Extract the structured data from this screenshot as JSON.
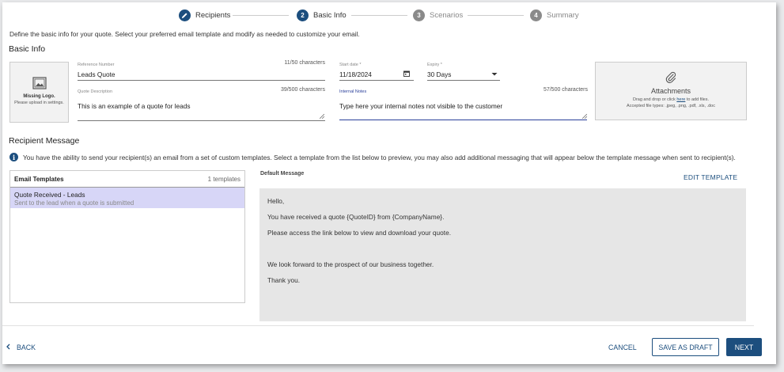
{
  "stepper": {
    "steps": [
      {
        "num": "",
        "label": "Recipients",
        "state": "done"
      },
      {
        "num": "2",
        "label": "Basic Info",
        "state": "active"
      },
      {
        "num": "3",
        "label": "Scenarios",
        "state": "todo"
      },
      {
        "num": "4",
        "label": "Summary",
        "state": "todo"
      }
    ]
  },
  "intro": "Define the basic info for your quote. Select your preferred email template and modify as needed to customize your email.",
  "basic_info": {
    "heading": "Basic Info",
    "logo": {
      "title": "Missing Logo.",
      "hint": "Please upload in settings."
    },
    "reference": {
      "label": "Reference Number",
      "count": "11/50 characters",
      "value": "Leads Quote"
    },
    "description": {
      "label": "Quote Description",
      "count": "39/500 characters",
      "value": "This is an example of a quote for leads"
    },
    "start_date": {
      "label": "Start date *",
      "value": "11/18/2024"
    },
    "expiry": {
      "label": "Expiry *",
      "value": "30 Days"
    },
    "internal_notes": {
      "label": "Internal Notes",
      "count": "57/500 characters",
      "value": "Type here your internal notes not visible to the customer"
    },
    "attachments": {
      "title": "Attachments",
      "line1_pre": "Drag and drop or click ",
      "line1_link": "here",
      "line1_post": " to add files.",
      "line2": "Accepted file types: .jpeg, .png, .pdf, .xls, .doc"
    }
  },
  "recipient": {
    "heading": "Recipient Message",
    "info": "You have the ability to send your recipient(s) an email from a set of custom templates. Select a template from the list below to preview, you may also add additional messaging that will appear below the template message when sent to recipient(s).",
    "templates_header": "Email Templates",
    "templates_count": "1 templates",
    "templates": [
      {
        "name": "Quote Received - Leads",
        "desc": "Sent to the lead when a quote is submitted"
      }
    ],
    "default_label": "Default Message",
    "edit_label": "EDIT TEMPLATE",
    "message_lines": [
      "Hello,",
      "You have received a quote {QuoteID} from {CompanyName}.",
      "Please access the link below to view and download your quote.",
      "We look forward to the prospect of our business together.",
      "Thank you."
    ]
  },
  "footer": {
    "back": "BACK",
    "cancel": "CANCEL",
    "save_draft": "SAVE AS DRAFT",
    "next": "NEXT"
  },
  "colors": {
    "primary": "#1c4e7e",
    "selected_row": "#d7d6f7",
    "message_bg": "#e6e6e6"
  }
}
